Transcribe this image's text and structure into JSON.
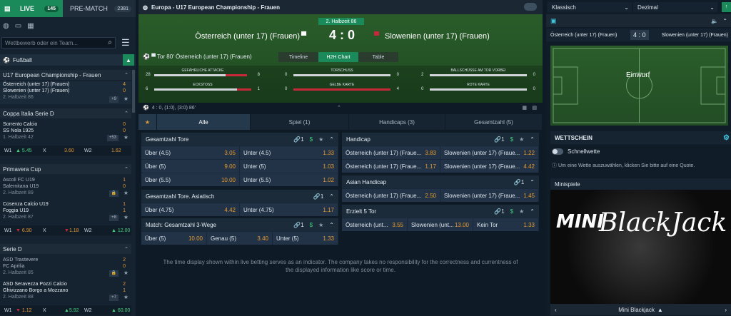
{
  "left": {
    "live_label": "LIVE",
    "live_count": "145",
    "prematch_label": "PRE-MATCH",
    "prematch_count": "2381",
    "search_placeholder": "Wettbewerb oder ein Team...",
    "sport": "Fußball",
    "leagues": [
      {
        "name": "U17 European Championship - Frauen",
        "matches": [
          {
            "t1": "Österreich (unter 17) (Frauen)",
            "t2": "Slowenien (unter 17) (Frauen)",
            "info": "2. Halbzeit 86",
            "s1": "4",
            "s2": "0",
            "plus": "+9"
          }
        ]
      },
      {
        "name": "Coppa Italia Serie D",
        "matches": [
          {
            "t1": "Sorrento Calcio",
            "t2": "SS Nola 1925",
            "info": "1. Halbzeit 42",
            "s1": "0",
            "s2": "0",
            "plus": "+53"
          }
        ],
        "odds": {
          "w1": "W1",
          "v1": "5.45",
          "x": "X",
          "vx": "3.60",
          "w2": "W2",
          "v2": "1.62"
        }
      },
      {
        "name": "Primavera Cup",
        "matches": [
          {
            "t1": "Ascoli FC U19",
            "t2": "Salernitana U19",
            "info": "2. Halbzeit 89",
            "s1": "1",
            "s2": "0",
            "plus": ""
          },
          {
            "t1": "Cosenza Calcio U19",
            "t2": "Foggia U19",
            "info": "2. Halbzeit 87",
            "s1": "1",
            "s2": "1",
            "plus": "+8"
          }
        ],
        "odds": {
          "w1": "W1",
          "v1": "6.90",
          "x": "X",
          "vx": "1.18",
          "w2": "W2",
          "v2": "12.00"
        }
      },
      {
        "name": "Serie D",
        "matches": [
          {
            "t1": "ASD Trastevere",
            "t2": "FC Aprilia",
            "info": "2. Halbzeit 85",
            "s1": "2",
            "s2": "0",
            "plus": ""
          },
          {
            "t1": "ASD Seravezza Pozzi Calcio",
            "t2": "Ghivizzano Borgo a Mozzano",
            "info": "2. Halbzeit 88",
            "s1": "2",
            "s2": "1",
            "plus": "+7"
          }
        ],
        "odds": {
          "w1": "W1",
          "v1": "1.12",
          "x": "X",
          "vx": "5.92",
          "w2": "W2",
          "v2": "60.00"
        }
      }
    ]
  },
  "center": {
    "header": "Europa - U17 European Championship - Frauen",
    "half": "2. Halbzeit 86",
    "home": "Österreich (unter 17) (Frauen)",
    "away": "Slowenien (unter 17) (Frauen)",
    "score": "4 : 0",
    "event": "Tor 80' Österreich (unter 17) (Frauen)",
    "view_tabs": [
      "Timeline",
      "H2H Chart",
      "Table"
    ],
    "stats": [
      {
        "label": "GEFÄHRLICHE ATTACKE",
        "a": "28",
        "b": "8"
      },
      {
        "label": "TORSCHUSS",
        "a": "0",
        "b": "0"
      },
      {
        "label": "BALLSCHÜSSE AM TOR VORBEI",
        "a": "2",
        "b": "0"
      },
      {
        "label": "ECKSTOSS",
        "a": "6",
        "b": "1"
      },
      {
        "label": "GELBE KARTE",
        "a": "0",
        "b": "4"
      },
      {
        "label": "ROTE KARTE",
        "a": "0",
        "b": "0"
      }
    ],
    "halftimes": "4 : 0, (1:0), (3:0) 86'",
    "bet_tabs": [
      "Alle",
      "Spiel (1)",
      "Handicaps (3)",
      "Gesamtzahl (5)"
    ],
    "markets_left": [
      {
        "title": "Gesamtzahl Tore",
        "link": "1",
        "rows": [
          [
            [
              "Über (4.5)",
              "3.05"
            ],
            [
              "Unter (4.5)",
              "1.33"
            ]
          ],
          [
            [
              "Über (5)",
              "9.00"
            ],
            [
              "Unter (5)",
              "1.03"
            ]
          ],
          [
            [
              "Über (5.5)",
              "10.00"
            ],
            [
              "Unter (5.5)",
              "1.02"
            ]
          ]
        ]
      },
      {
        "title": "Gesamtzahl Tore. Asiatisch",
        "link": "1",
        "rows": [
          [
            [
              "Über (4.75)",
              "4.42"
            ],
            [
              "Unter (4.75)",
              "1.17"
            ]
          ]
        ]
      },
      {
        "title": "Match: Gesamtzahl 3-Wege",
        "link": "1",
        "rows": [
          [
            [
              "Über (5)",
              "10.00"
            ],
            [
              "Genau (5)",
              "3.40"
            ],
            [
              "Unter (5)",
              "1.33"
            ]
          ]
        ]
      }
    ],
    "markets_right": [
      {
        "title": "Handicap",
        "link": "1",
        "rows": [
          [
            [
              "Österreich (unter 17) (Fraue...",
              "3.83"
            ],
            [
              "Slowenien (unter 17) (Fraue...",
              "1.22"
            ]
          ],
          [
            [
              "Österreich (unter 17) (Fraue...",
              "1.17"
            ],
            [
              "Slowenien (unter 17) (Fraue...",
              "4.42"
            ]
          ]
        ]
      },
      {
        "title": "Asian Handicap",
        "link": "1",
        "rows": [
          [
            [
              "Österreich (unter 17) (Fraue...",
              "2.50"
            ],
            [
              "Slowenien (unter 17) (Fraue...",
              "1.45"
            ]
          ]
        ]
      },
      {
        "title": "Erzielt 5 Tor",
        "link": "1",
        "rows": [
          [
            [
              "Österreich (unt...",
              "3.55"
            ],
            [
              "Slowenien (unt...",
              "13.00"
            ],
            [
              "Kein Tor",
              "1.33"
            ]
          ]
        ]
      }
    ],
    "note1": "The time display shown within live betting serves as an indicator. The company takes no responsibility for the correctness and currentness of",
    "note2": "the displayed information like score or time."
  },
  "right": {
    "format": "Klassisch",
    "odds_type": "Dezimal",
    "home": "Österreich (unter 17) (Frauen)",
    "score": "4 : 0",
    "away": "Slowenien (unter 17) (Frauen)",
    "pitch_event": "Einwurf",
    "betslip": "WETTSCHEIN",
    "quick": "Schnellwette",
    "hint": "Um eine Wette auszuwählen, klicken Sie bitte auf eine Quote.",
    "minigames": "Minispiele",
    "mini_logo1": "MINI",
    "mini_logo2": "BlackJack",
    "mini_name": "Mini Blackjack"
  },
  "colors": {
    "accent": "#1b8a5a",
    "odd": "#e69a2c",
    "red": "#c8283a"
  }
}
